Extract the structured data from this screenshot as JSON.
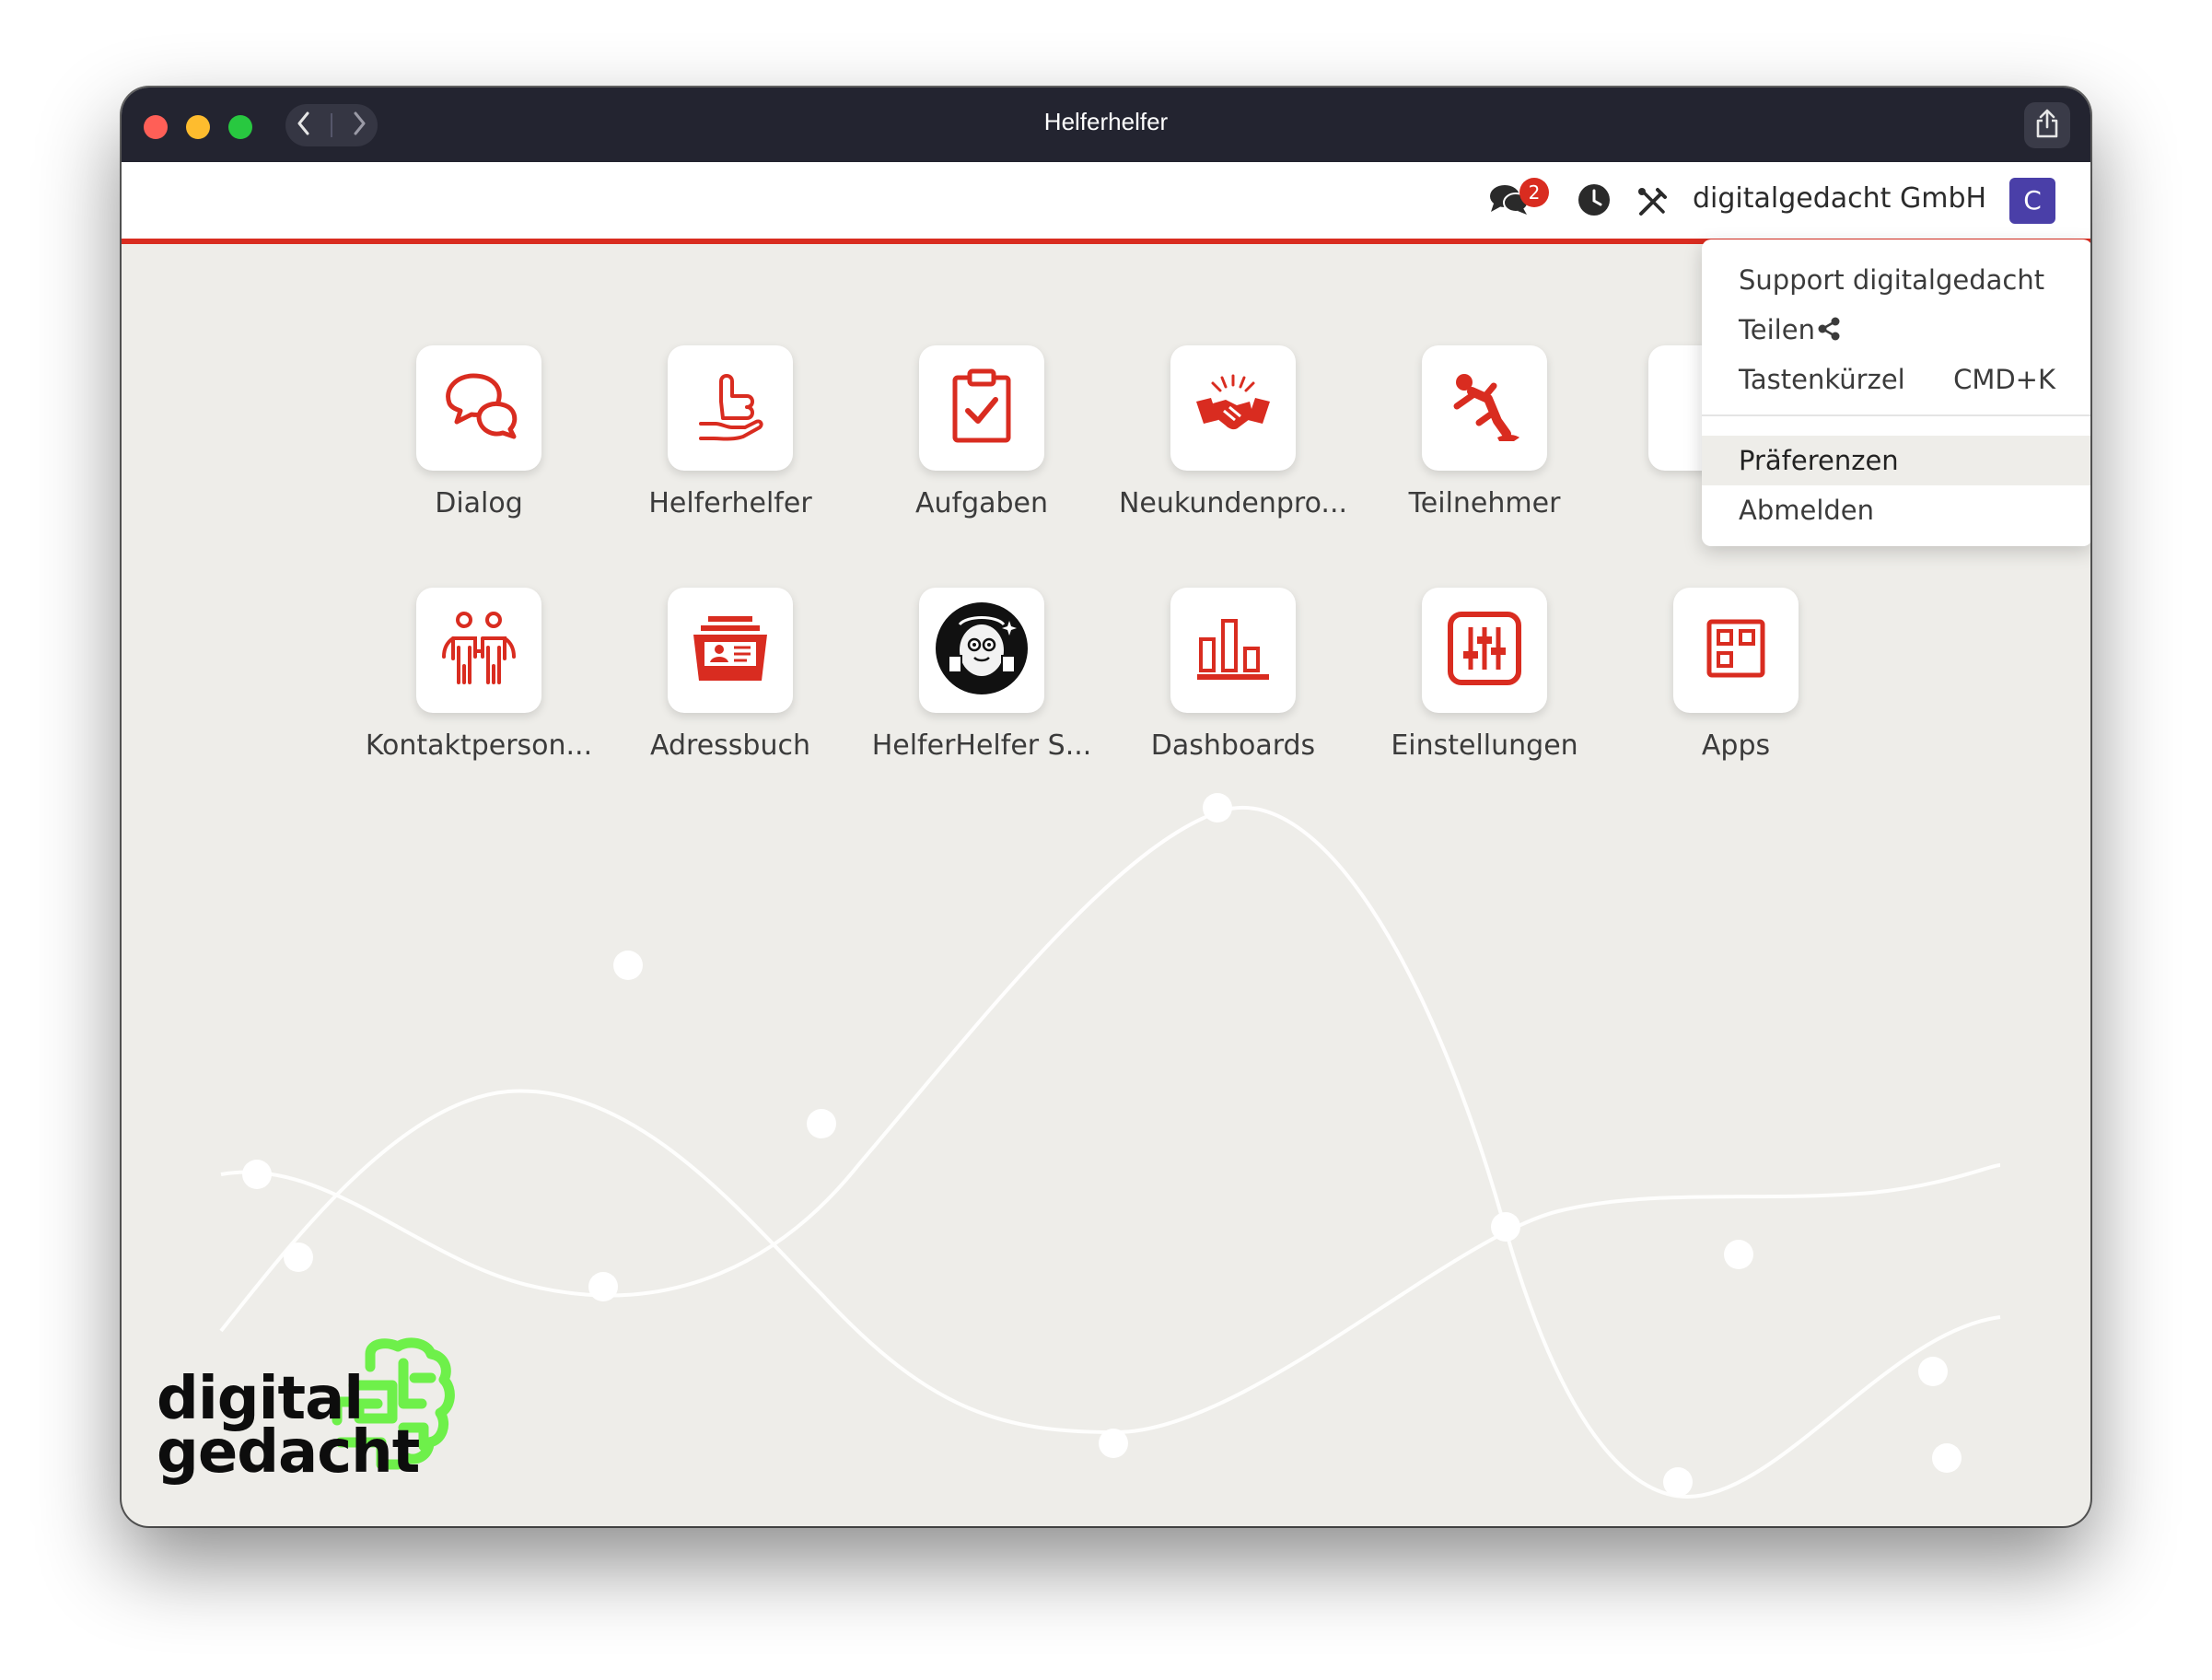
{
  "window": {
    "title": "Helferhelfer"
  },
  "header": {
    "chat_badge": "2",
    "company": "digitalgedacht GmbH",
    "avatar_letter": "C"
  },
  "tiles": [
    {
      "label": "Dialog",
      "icon": "chat-bubbles-icon"
    },
    {
      "label": "Helferhelfer",
      "icon": "hand-thumbs-up-icon"
    },
    {
      "label": "Aufgaben",
      "icon": "clipboard-check-icon"
    },
    {
      "label": "Neukundenpro...",
      "icon": "handshake-icon"
    },
    {
      "label": "Teilnehmer",
      "icon": "slipping-person-icon"
    },
    {
      "label": "Kontaktperson...",
      "icon": "people-icon"
    },
    {
      "label": "Adressbuch",
      "icon": "address-book-icon"
    },
    {
      "label": "HelferHelfer S...",
      "icon": "mascot-icon"
    },
    {
      "label": "Dashboards",
      "icon": "bar-chart-icon"
    },
    {
      "label": "Einstellungen",
      "icon": "sliders-icon"
    },
    {
      "label": "Apps",
      "icon": "apps-grid-icon"
    }
  ],
  "menu": {
    "support": "Support digitalgedacht",
    "share": "Teilen",
    "shortcuts": "Tastenkürzel",
    "shortcuts_key": "CMD+K",
    "preferences": "Präferenzen",
    "logout": "Abmelden"
  },
  "logo": {
    "line1": "digital",
    "line2": "gedacht"
  },
  "colors": {
    "accent": "#d92c20",
    "avatar": "#4a3fa8",
    "logo_green": "#6ef04a",
    "titlebar": "#232430",
    "background": "#eeede9"
  }
}
